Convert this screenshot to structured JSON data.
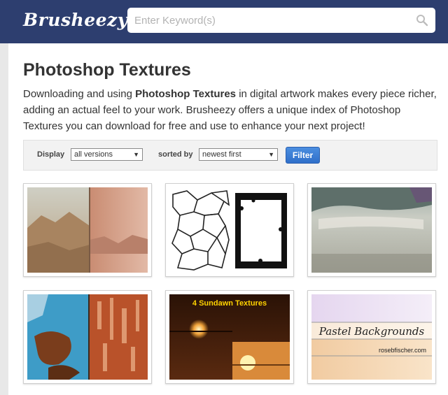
{
  "brand": {
    "logo_text": "Brusheezy"
  },
  "search": {
    "placeholder": "Enter Keyword(s)",
    "icon": "search-icon"
  },
  "page": {
    "title": "Photoshop Textures",
    "description_pre": "Downloading and using ",
    "description_bold": "Photoshop Textures",
    "description_post": " in digital artwork makes every piece richer, adding an actual feel to your work. Brusheezy offers a unique index of Photoshop Textures you can download for free and use to enhance your next project!"
  },
  "filters": {
    "display_label": "Display",
    "display_value": "all versions",
    "sort_label": "sorted by",
    "sort_value": "newest first",
    "filter_button": "Filter"
  },
  "thumbnails": [
    {
      "name": "thumbnail-mountain-texture"
    },
    {
      "name": "thumbnail-cracked-frame-texture"
    },
    {
      "name": "thumbnail-grunge-concrete-texture"
    },
    {
      "name": "thumbnail-rust-blue-texture"
    },
    {
      "name": "thumbnail-sundawn-textures",
      "caption": "4  Sundawn Textures"
    },
    {
      "name": "thumbnail-pastel-backgrounds",
      "caption": "Pastel Backgrounds",
      "credit": "rosebfischer.com"
    }
  ],
  "colors": {
    "header": "#2d3e6f",
    "accent": "#3a7bd5",
    "text": "#333333"
  }
}
